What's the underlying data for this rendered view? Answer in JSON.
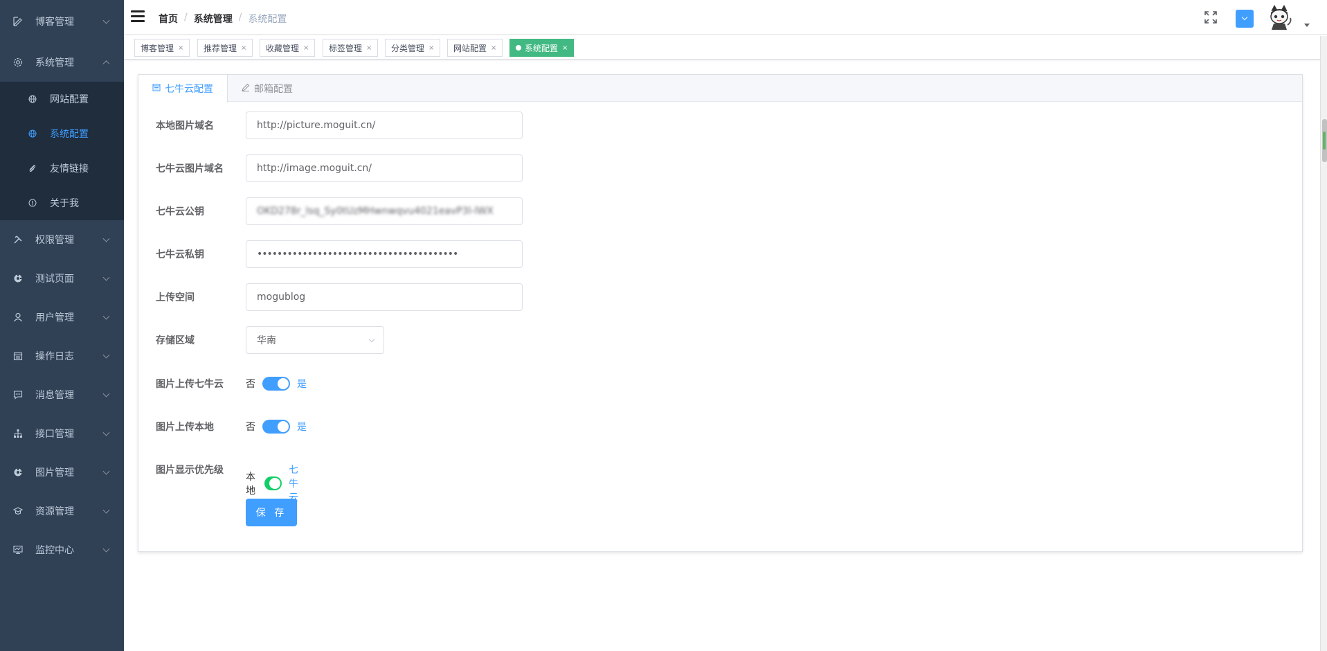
{
  "sidebar": {
    "items": [
      {
        "label": "博客管理",
        "icon": "edit-icon"
      },
      {
        "label": "系统管理",
        "icon": "gear-icon"
      },
      {
        "label": "权限管理",
        "icon": "tools-icon"
      },
      {
        "label": "测试页面",
        "icon": "target-icon"
      },
      {
        "label": "用户管理",
        "icon": "user-icon"
      },
      {
        "label": "操作日志",
        "icon": "calendar-icon"
      },
      {
        "label": "消息管理",
        "icon": "message-icon"
      },
      {
        "label": "接口管理",
        "icon": "api-icon"
      },
      {
        "label": "图片管理",
        "icon": "image-icon"
      },
      {
        "label": "资源管理",
        "icon": "graduation-icon"
      },
      {
        "label": "监控中心",
        "icon": "monitor-icon"
      }
    ],
    "submenu": [
      {
        "label": "网站配置",
        "icon": "globe-icon"
      },
      {
        "label": "系统配置",
        "icon": "globe-icon"
      },
      {
        "label": "友情链接",
        "icon": "paperclip-icon"
      },
      {
        "label": "关于我",
        "icon": "info-icon"
      }
    ]
  },
  "navbar": {
    "breadcrumb": [
      "首页",
      "系统管理",
      "系统配置"
    ],
    "breadcrumb_sep": "/"
  },
  "tags": [
    {
      "label": "博客管理",
      "close": "×"
    },
    {
      "label": "推荐管理",
      "close": "×"
    },
    {
      "label": "收藏管理",
      "close": "×"
    },
    {
      "label": "标签管理",
      "close": "×"
    },
    {
      "label": "分类管理",
      "close": "×"
    },
    {
      "label": "网站配置",
      "close": "×"
    },
    {
      "label": "系统配置",
      "close": "×"
    }
  ],
  "tabs": [
    {
      "label": "七牛云配置",
      "icon": "calendar-icon"
    },
    {
      "label": "邮箱配置",
      "icon": "pencil-icon"
    }
  ],
  "form": {
    "local_domain": {
      "label": "本地图片域名",
      "value": "http://picture.moguit.cn/"
    },
    "qiniu_domain": {
      "label": "七牛云图片域名",
      "value": "http://image.moguit.cn/"
    },
    "access_key": {
      "label": "七牛云公钥",
      "value": "OKD278r_lsq_Sy0tUzMHwnwqvu4021eavP3l-lWX"
    },
    "secret_key": {
      "label": "七牛云私钥",
      "value": "••••••••••••••••••••••••••••••••••••••••"
    },
    "bucket": {
      "label": "上传空间",
      "value": "mogublog"
    },
    "area": {
      "label": "存储区域",
      "value": "华南"
    },
    "upload_qiniu": {
      "label": "图片上传七牛云",
      "off": "否",
      "on": "是"
    },
    "upload_local": {
      "label": "图片上传本地",
      "off": "否",
      "on": "是"
    },
    "priority": {
      "label": "图片显示优先级",
      "off": "本地",
      "on": "七牛云"
    },
    "save": "保 存"
  },
  "colors": {
    "primary": "#409eff",
    "sidebar": "#304156",
    "active_tag": "#42b983",
    "switch_green": "#13ce66"
  }
}
